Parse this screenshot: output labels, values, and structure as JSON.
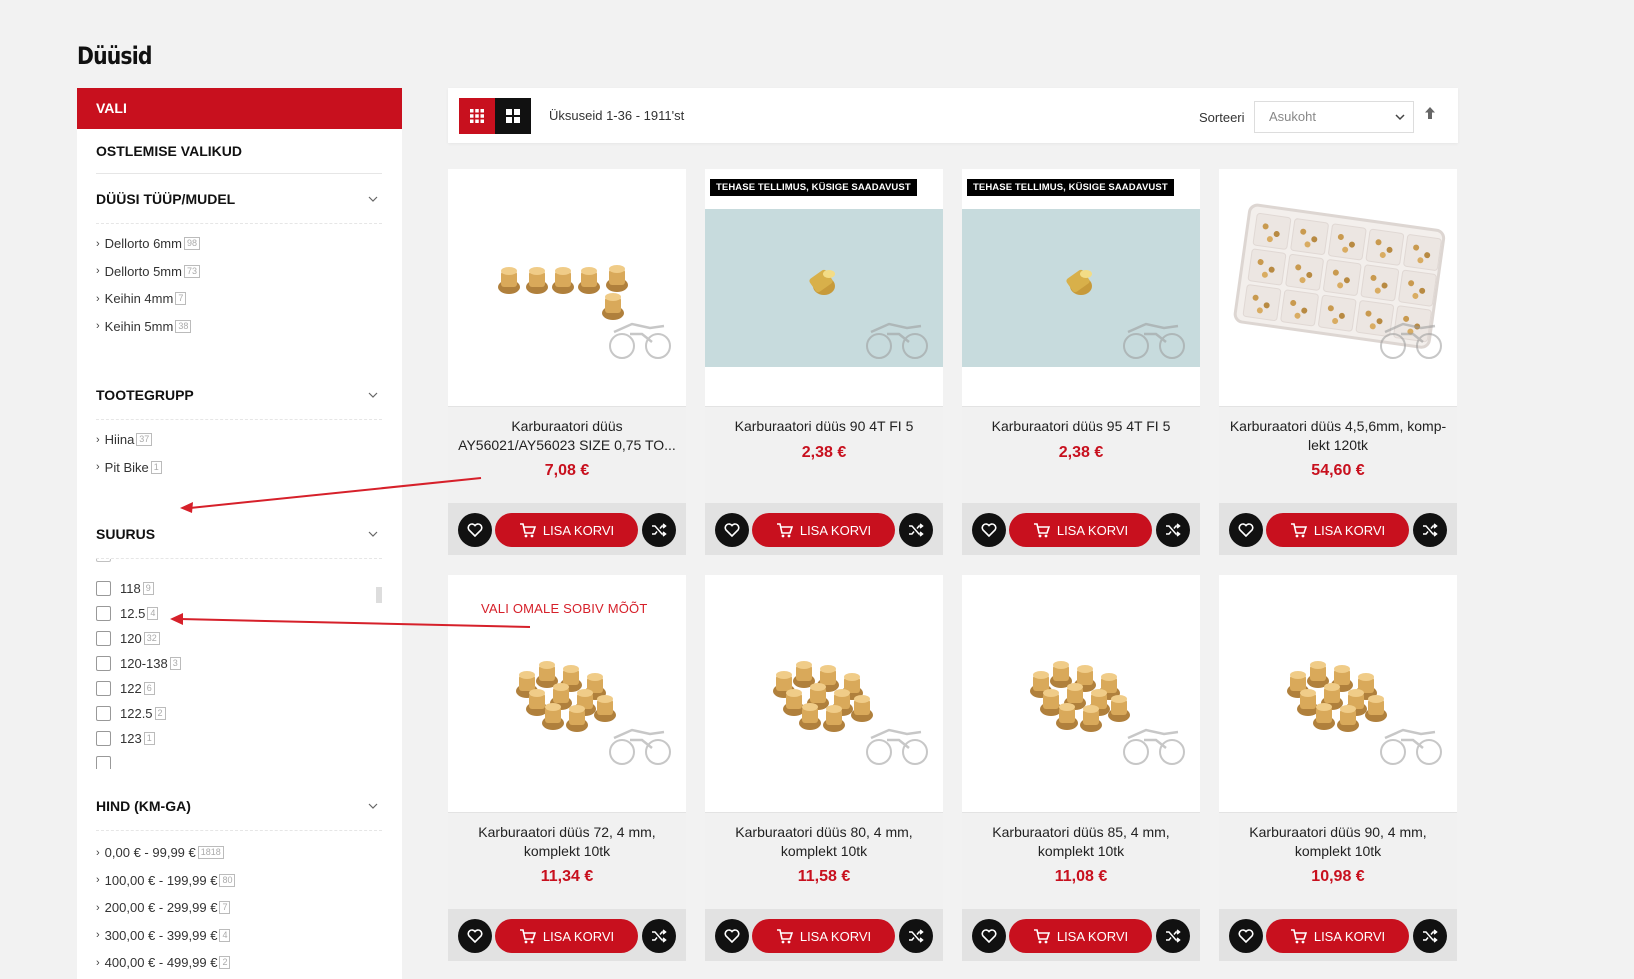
{
  "page": {
    "title": "Düüsid"
  },
  "sidebar": {
    "header": "VALI",
    "shopping_options": "OSTLEMISE VALIKUD",
    "sections": [
      {
        "title": "DÜÜSI TÜÜP/MUDEL",
        "items": [
          {
            "label": "Dellorto 6mm",
            "count": "98"
          },
          {
            "label": "Dellorto 5mm",
            "count": "73"
          },
          {
            "label": "Keihin 4mm",
            "count": "7"
          },
          {
            "label": "Keihin 5mm",
            "count": "38"
          }
        ]
      },
      {
        "title": "TOOTEGRUPP",
        "items": [
          {
            "label": "Hiina",
            "count": "37"
          },
          {
            "label": "Pit Bike",
            "count": "1"
          }
        ]
      },
      {
        "title": "SUURUS",
        "items": [
          {
            "label": "118",
            "count": "9"
          },
          {
            "label": "12.5",
            "count": "4"
          },
          {
            "label": "120",
            "count": "32"
          },
          {
            "label": "120-138",
            "count": "3"
          },
          {
            "label": "122",
            "count": "6"
          },
          {
            "label": "122.5",
            "count": "2"
          },
          {
            "label": "123",
            "count": "1"
          }
        ]
      },
      {
        "title": "HIND (KM-GA)",
        "items": [
          {
            "label": "0,00 € - 99,99 €",
            "count": "1818"
          },
          {
            "label": "100,00 € - 199,99 €",
            "count": "80"
          },
          {
            "label": "200,00 € - 299,99 €",
            "count": "7"
          },
          {
            "label": "300,00 € - 399,99 €",
            "count": "4"
          },
          {
            "label": "400,00 € - 499,99 €",
            "count": "2"
          }
        ]
      }
    ]
  },
  "toolbar": {
    "results": "Üksuseid 1-36 - 1911'st",
    "sort_label": "Sorteeri",
    "sort_value": "Asukoht",
    "grid_icon": "grid-icon",
    "list_icon": "list-icon"
  },
  "annotation_note": "VALI OMALE SOBIV MÕÕT",
  "products": [
    {
      "name": "Karburaatori düüs AY56021/AY56023 SIZE 0,75 TO...",
      "price": "7,08 €",
      "badge": "",
      "cart": "LISA KORVI"
    },
    {
      "name": "Karburaatori düüs 90 4T FI 5",
      "price": "2,38 €",
      "badge": "TEHASE TELLIMUS, KÜSIGE SAADAVUST",
      "cart": "LISA KORVI"
    },
    {
      "name": "Karburaatori düüs 95 4T FI 5",
      "price": "2,38 €",
      "badge": "TEHASE TELLIMUS, KÜSIGE SAADAVUST",
      "cart": "LISA KORVI"
    },
    {
      "name": "Karburaatori düüs 4,5,6mm, komp-lekt 120tk",
      "price": "54,60 €",
      "badge": "",
      "cart": "LISA KORVI"
    },
    {
      "name": "Karburaatori düüs 72, 4 mm, komplekt 10tk",
      "price": "11,34 €",
      "badge": "",
      "cart": "LISA KORVI"
    },
    {
      "name": "Karburaatori düüs 80, 4 mm, komplekt 10tk",
      "price": "11,58 €",
      "badge": "",
      "cart": "LISA KORVI"
    },
    {
      "name": "Karburaatori düüs 85, 4 mm, komplekt 10tk",
      "price": "11,08 €",
      "badge": "",
      "cart": "LISA KORVI"
    },
    {
      "name": "Karburaatori düüs 90, 4 mm, komplekt 10tk",
      "price": "10,98 €",
      "badge": "",
      "cart": "LISA KORVI"
    }
  ],
  "colors": {
    "accent": "#c8101e",
    "dark": "#111111",
    "background": "#f2f2f2"
  }
}
